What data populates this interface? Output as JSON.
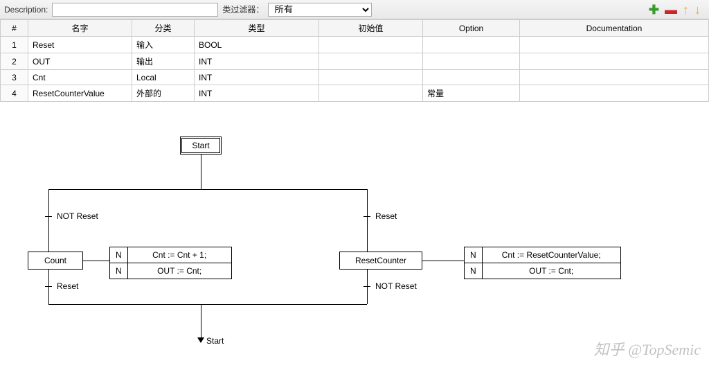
{
  "toolbar": {
    "desc_label": "Description:",
    "desc_value": "",
    "filter_label": "类过滤器：",
    "filter_selected": "所有"
  },
  "columns": {
    "idx": "#",
    "name": "名字",
    "cat": "分类",
    "type": "类型",
    "init": "初始值",
    "opt": "Option",
    "doc": "Documentation"
  },
  "rows": [
    {
      "idx": "1",
      "name": "Reset",
      "cat": "输入",
      "type": "BOOL",
      "init": "",
      "opt": "",
      "doc": ""
    },
    {
      "idx": "2",
      "name": "OUT",
      "cat": "输出",
      "type": "INT",
      "init": "",
      "opt": "",
      "doc": ""
    },
    {
      "idx": "3",
      "name": "Cnt",
      "cat": "Local",
      "type": "INT",
      "init": "",
      "opt": "",
      "doc": ""
    },
    {
      "idx": "4",
      "name": "ResetCounterValue",
      "cat": "外部的",
      "type": "INT",
      "init": "",
      "opt": "常量",
      "doc": ""
    }
  ],
  "sfc": {
    "start": "Start",
    "not_reset": "NOT Reset",
    "reset": "Reset",
    "count": "Count",
    "reset_counter": "ResetCounter",
    "n": "N",
    "a1": "Cnt := Cnt + 1;",
    "a2": "OUT := Cnt;",
    "a3": "Cnt := ResetCounterValue;",
    "a4": "OUT := Cnt;",
    "loop": "Start"
  },
  "watermark": "知乎 @TopSemic"
}
